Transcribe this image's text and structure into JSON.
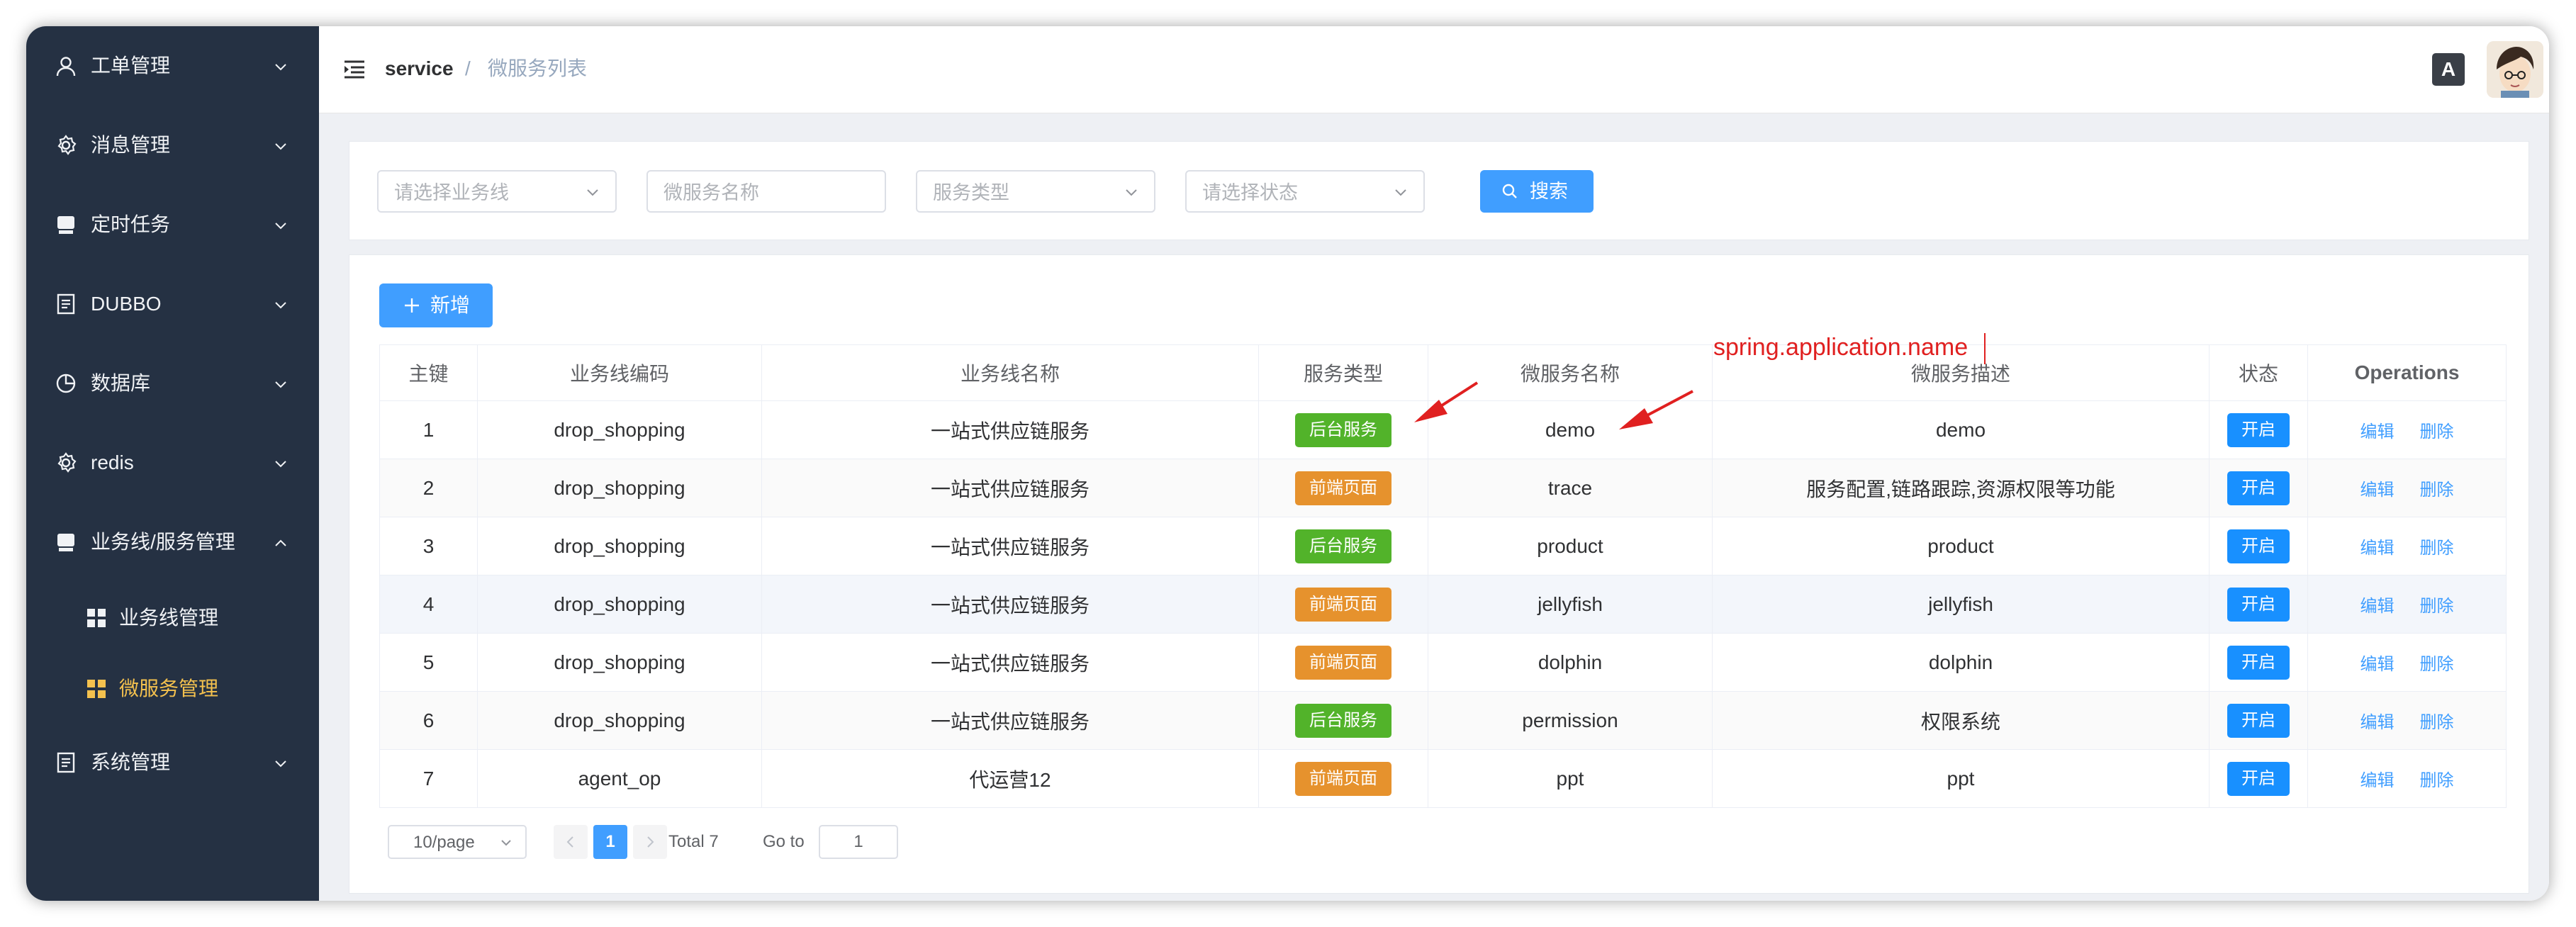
{
  "sidebar": {
    "items": [
      {
        "label": "工单管理",
        "icon": "user-icon"
      },
      {
        "label": "消息管理",
        "icon": "gear-icon"
      },
      {
        "label": "定时任务",
        "icon": "monitor-icon"
      },
      {
        "label": "DUBBO",
        "icon": "document-icon"
      },
      {
        "label": "数据库",
        "icon": "pie-chart-icon"
      },
      {
        "label": "redis",
        "icon": "gear-icon"
      },
      {
        "label": "业务线/服务管理",
        "icon": "monitor-icon"
      },
      {
        "label": "系统管理",
        "icon": "document-icon"
      }
    ],
    "sub_items": [
      {
        "label": "业务线管理",
        "icon": "grid-icon"
      },
      {
        "label": "微服务管理",
        "icon": "grid-icon",
        "active": true
      }
    ],
    "active_color": "#f4c14e"
  },
  "navbar": {
    "breadcrumb_root": "service",
    "breadcrumb_sep": "/",
    "breadcrumb_current": "微服务列表",
    "lang_icon_text": "A"
  },
  "filters": {
    "business_line_placeholder": "请选择业务线",
    "service_name_placeholder": "微服务名称",
    "service_type_placeholder": "服务类型",
    "status_placeholder": "请选择状态",
    "search_label": "搜索"
  },
  "toolbar": {
    "add_label": "新增"
  },
  "table": {
    "headers": [
      "主键",
      "业务线编码",
      "业务线名称",
      "服务类型",
      "微服务名称",
      "微服务描述",
      "状态",
      "Operations"
    ],
    "rows": [
      {
        "id": "1",
        "code": "drop_shopping",
        "name": "一站式供应链服务",
        "type": "后台服务",
        "type_color": "green",
        "service": "demo",
        "desc": "demo",
        "state": "开启",
        "edit": "编辑",
        "del": "删除"
      },
      {
        "id": "2",
        "code": "drop_shopping",
        "name": "一站式供应链服务",
        "type": "前端页面",
        "type_color": "orange",
        "service": "trace",
        "desc": "服务配置,链路跟踪,资源权限等功能",
        "state": "开启",
        "edit": "编辑",
        "del": "删除"
      },
      {
        "id": "3",
        "code": "drop_shopping",
        "name": "一站式供应链服务",
        "type": "后台服务",
        "type_color": "green",
        "service": "product",
        "desc": "product",
        "state": "开启",
        "edit": "编辑",
        "del": "删除"
      },
      {
        "id": "4",
        "code": "drop_shopping",
        "name": "一站式供应链服务",
        "type": "前端页面",
        "type_color": "orange",
        "service": "jellyfish",
        "desc": "jellyfish",
        "state": "开启",
        "edit": "编辑",
        "del": "删除"
      },
      {
        "id": "5",
        "code": "drop_shopping",
        "name": "一站式供应链服务",
        "type": "前端页面",
        "type_color": "orange",
        "service": "dolphin",
        "desc": "dolphin",
        "state": "开启",
        "edit": "编辑",
        "del": "删除"
      },
      {
        "id": "6",
        "code": "drop_shopping",
        "name": "一站式供应链服务",
        "type": "后台服务",
        "type_color": "green",
        "service": "permission",
        "desc": "权限系统",
        "state": "开启",
        "edit": "编辑",
        "del": "删除"
      },
      {
        "id": "7",
        "code": "agent_op",
        "name": "代运营12",
        "type": "前端页面",
        "type_color": "orange",
        "service": "ppt",
        "desc": "ppt",
        "state": "开启",
        "edit": "编辑",
        "del": "删除"
      }
    ],
    "tag_colors": {
      "green": "#52b32a",
      "orange": "#e6922d"
    }
  },
  "pagination": {
    "page_size": "10/page",
    "current_page": "1",
    "total": "Total 7",
    "goto_label": "Go to",
    "goto_value": "1"
  },
  "annotation": {
    "text": "spring.application.name",
    "color": "#e02020"
  }
}
